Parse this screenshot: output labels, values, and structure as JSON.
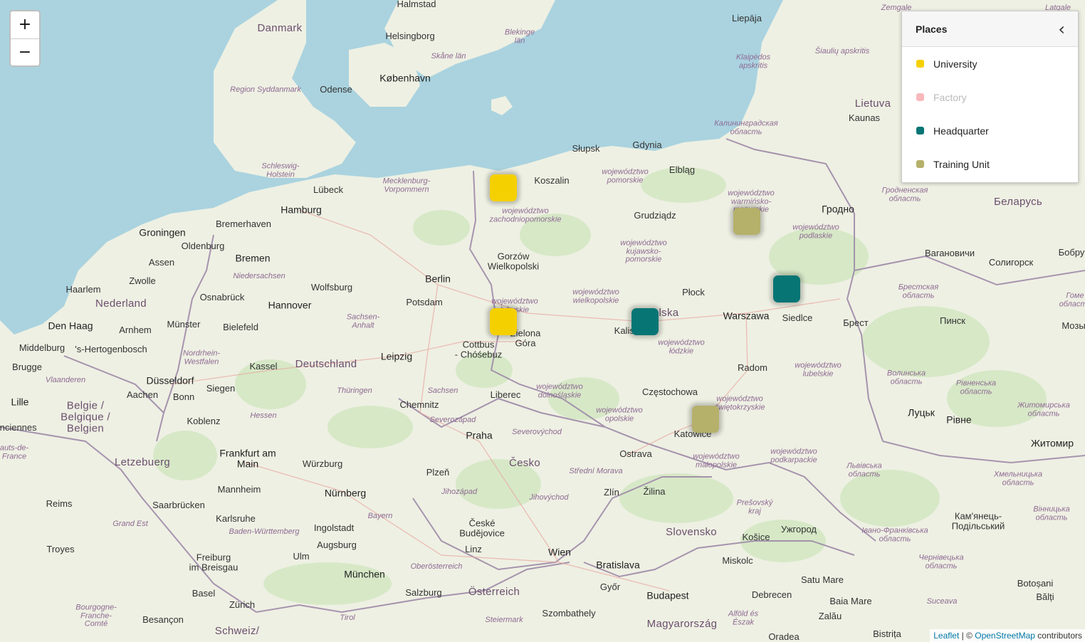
{
  "map": {
    "labels": [
      {
        "text": "Halmstad",
        "cls": ""
      },
      {
        "text": "Danmark",
        "cls": "country"
      },
      {
        "text": "Helsingborg",
        "cls": ""
      },
      {
        "text": "Blekinge\nlän",
        "cls": "region"
      },
      {
        "text": "Skåne län",
        "cls": "region"
      },
      {
        "text": "København",
        "cls": "city-major"
      },
      {
        "text": "Region Syddanmark",
        "cls": "region"
      },
      {
        "text": "Odense",
        "cls": ""
      },
      {
        "text": "Liepāja",
        "cls": ""
      },
      {
        "text": "Zemgale",
        "cls": "region"
      },
      {
        "text": "Latgale",
        "cls": "region"
      },
      {
        "text": "Klaipėdos\napskritis",
        "cls": "region"
      },
      {
        "text": "Šiaulių apskritis",
        "cls": "region"
      },
      {
        "text": "Lietuva",
        "cls": "country"
      },
      {
        "text": "Kaunas",
        "cls": ""
      },
      {
        "text": "Калининградская\nобласть",
        "cls": "region"
      },
      {
        "text": "Schleswig-\nHolstein",
        "cls": "region"
      },
      {
        "text": "Mecklenburg-\nVorpommern",
        "cls": "region"
      },
      {
        "text": "Lübeck",
        "cls": ""
      },
      {
        "text": "Koszalin",
        "cls": ""
      },
      {
        "text": "Słupsk",
        "cls": ""
      },
      {
        "text": "Gdynia",
        "cls": ""
      },
      {
        "text": "województwo\npomorskie",
        "cls": "region"
      },
      {
        "text": "Elbląg",
        "cls": ""
      },
      {
        "text": "województwo\nwarmińsko-\nmazurskie",
        "cls": "region"
      },
      {
        "text": "Гродненская\nобласть",
        "cls": "region"
      },
      {
        "text": "Беларусь",
        "cls": "country"
      },
      {
        "text": "Гродно",
        "cls": "city-major"
      },
      {
        "text": "Hamburg",
        "cls": "city-major"
      },
      {
        "text": "Groningen",
        "cls": "city-major"
      },
      {
        "text": "Bremerhaven",
        "cls": ""
      },
      {
        "text": "Oldenburg",
        "cls": ""
      },
      {
        "text": "Bremen",
        "cls": "city-major"
      },
      {
        "text": "województwo\nzachodniopomorskie",
        "cls": "region"
      },
      {
        "text": "Grudziądz",
        "cls": ""
      },
      {
        "text": "województwo\npodlaskie",
        "cls": "region"
      },
      {
        "text": "województwo\nkujawsko-\npomorskie",
        "cls": "region"
      },
      {
        "text": "Gorzów\nWielkopolski",
        "cls": ""
      },
      {
        "text": "Assen",
        "cls": ""
      },
      {
        "text": "Zwolle",
        "cls": ""
      },
      {
        "text": "Niedersachsen",
        "cls": "region"
      },
      {
        "text": "Barанoвичи",
        "cls": ""
      },
      {
        "text": "Солигорск",
        "cls": ""
      },
      {
        "text": "Бобру",
        "cls": ""
      },
      {
        "text": "Berlin",
        "cls": "city-major"
      },
      {
        "text": "Haarlem",
        "cls": ""
      },
      {
        "text": "Osnabrück",
        "cls": ""
      },
      {
        "text": "Wolfsburg",
        "cls": ""
      },
      {
        "text": "Potsdam",
        "cls": ""
      },
      {
        "text": "Płock",
        "cls": ""
      },
      {
        "text": "Siedlce",
        "cls": ""
      },
      {
        "text": "Брестская\nобласть",
        "cls": "region"
      },
      {
        "text": "Гоме\nобласть",
        "cls": "region"
      },
      {
        "text": "Nederland",
        "cls": "country"
      },
      {
        "text": "Hannover",
        "cls": "city-major"
      },
      {
        "text": "województwo\nlubuskie",
        "cls": "region"
      },
      {
        "text": "województwo\nwielkopolskie",
        "cls": "region"
      },
      {
        "text": "Polska",
        "cls": "country"
      },
      {
        "text": "Warszawa",
        "cls": "city-major"
      },
      {
        "text": "Брест",
        "cls": ""
      },
      {
        "text": "Пинск",
        "cls": ""
      },
      {
        "text": "Мозы",
        "cls": ""
      },
      {
        "text": "Den Haag",
        "cls": "city-major"
      },
      {
        "text": "Arnhem",
        "cls": ""
      },
      {
        "text": "Münster",
        "cls": ""
      },
      {
        "text": "Bielefeld",
        "cls": ""
      },
      {
        "text": "Sachsen-\nAnhalt",
        "cls": "region"
      },
      {
        "text": "Zielona\nGóra",
        "cls": ""
      },
      {
        "text": "Kalisz",
        "cls": ""
      },
      {
        "text": "województwo\nłódzkie",
        "cls": "region"
      },
      {
        "text": "Middelburg",
        "cls": ""
      },
      {
        "text": "'s-Hertogenbosch",
        "cls": ""
      },
      {
        "text": "Nordrhein-\nWestfalen",
        "cls": "region"
      },
      {
        "text": "Cottbus\n- Chóśebuz",
        "cls": ""
      },
      {
        "text": "Leipzig",
        "cls": "city-major"
      },
      {
        "text": "Radom",
        "cls": ""
      },
      {
        "text": "województwo\nlubelskie",
        "cls": "region"
      },
      {
        "text": "Волинська\nобласть",
        "cls": "region"
      },
      {
        "text": "Рівненська\nобласть",
        "cls": "region"
      },
      {
        "text": "Житомирська\nобласть",
        "cls": "region"
      },
      {
        "text": "Brugge",
        "cls": ""
      },
      {
        "text": "Düsseldorf",
        "cls": "city-major"
      },
      {
        "text": "Kassel",
        "cls": ""
      },
      {
        "text": "Deutschland",
        "cls": "country"
      },
      {
        "text": "Vlaanderen",
        "cls": "region"
      },
      {
        "text": "Aachen",
        "cls": ""
      },
      {
        "text": "Siegen",
        "cls": ""
      },
      {
        "text": "Thüringen",
        "cls": "region"
      },
      {
        "text": "Sachsen",
        "cls": "region"
      },
      {
        "text": "Liberec",
        "cls": ""
      },
      {
        "text": "województwo\ndolnośląskie",
        "cls": "region"
      },
      {
        "text": "Częstochowa",
        "cls": ""
      },
      {
        "text": "województwo\nświętokrzyskie",
        "cls": "region"
      },
      {
        "text": "Lille",
        "cls": "city-major"
      },
      {
        "text": "Bonn",
        "cls": ""
      },
      {
        "text": "Belgie /\nBelgique /\nBelgien",
        "cls": "country"
      },
      {
        "text": "Chemnitz",
        "cls": ""
      },
      {
        "text": "Луцьк",
        "cls": "city-major"
      },
      {
        "text": "Рівне",
        "cls": "city-major"
      },
      {
        "text": "Hessen",
        "cls": "region"
      },
      {
        "text": "Koblenz",
        "cls": ""
      },
      {
        "text": "Severozápad",
        "cls": "region"
      },
      {
        "text": "województwo\nopolskie",
        "cls": "region"
      },
      {
        "text": "Katowice",
        "cls": ""
      },
      {
        "text": "Житомир",
        "cls": "city-major"
      },
      {
        "text": "Praha",
        "cls": "city-major"
      },
      {
        "text": "Severovýchod",
        "cls": "region"
      },
      {
        "text": "Ostrava",
        "cls": ""
      },
      {
        "text": "Frankfurt am\nMain",
        "cls": "city-major"
      },
      {
        "text": "Würzburg",
        "cls": ""
      },
      {
        "text": "Letzebuerg",
        "cls": "country"
      },
      {
        "text": "Plzeň",
        "cls": ""
      },
      {
        "text": "Česko",
        "cls": "country"
      },
      {
        "text": "województwo\nmałopolskie",
        "cls": "region"
      },
      {
        "text": "województwo\npodkarpackie",
        "cls": "region"
      },
      {
        "text": "Львівська\nобласть",
        "cls": "region"
      },
      {
        "text": "Хмельницька\nобласть",
        "cls": "region"
      },
      {
        "text": "Mannheim",
        "cls": ""
      },
      {
        "text": "Nürnberg",
        "cls": "city-major"
      },
      {
        "text": "Střední Morava",
        "cls": "region"
      },
      {
        "text": "Jihozápad",
        "cls": "region"
      },
      {
        "text": "Zlín",
        "cls": ""
      },
      {
        "text": "Žilina",
        "cls": ""
      },
      {
        "text": "Reims",
        "cls": ""
      },
      {
        "text": "Saarbrücken",
        "cls": ""
      },
      {
        "text": "Jihovýchod",
        "cls": "region"
      },
      {
        "text": "Prešovský\nkraj",
        "cls": "region"
      },
      {
        "text": "Кам'янець-\nПодільський",
        "cls": ""
      },
      {
        "text": "Вінницька\nобласть",
        "cls": "region"
      },
      {
        "text": "Karlsruhe",
        "cls": ""
      },
      {
        "text": "Bayern",
        "cls": "region"
      },
      {
        "text": "České\nBudějovice",
        "cls": ""
      },
      {
        "text": "Grand Est",
        "cls": "region"
      },
      {
        "text": "Baden-Württemberg",
        "cls": "region"
      },
      {
        "text": "Ingolstadt",
        "cls": ""
      },
      {
        "text": "Slovensko",
        "cls": "country"
      },
      {
        "text": "Košice",
        "cls": ""
      },
      {
        "text": "Ужгород",
        "cls": ""
      },
      {
        "text": "Івано-Франківська\nобласть",
        "cls": "region"
      },
      {
        "text": "Augsburg",
        "cls": ""
      },
      {
        "text": "Linz",
        "cls": ""
      },
      {
        "text": "Troyes",
        "cls": ""
      },
      {
        "text": "Wien",
        "cls": "city-major"
      },
      {
        "text": "Ulm",
        "cls": ""
      },
      {
        "text": "Freiburg\nim Breisgau",
        "cls": ""
      },
      {
        "text": "Bratislava",
        "cls": "city-major"
      },
      {
        "text": "Miskolc",
        "cls": ""
      },
      {
        "text": "Чернівецька\nобласть",
        "cls": "region"
      },
      {
        "text": "Oberösterreich",
        "cls": "region"
      },
      {
        "text": "München",
        "cls": "city-major"
      },
      {
        "text": "Satu Mare",
        "cls": ""
      },
      {
        "text": "Botoșani",
        "cls": ""
      },
      {
        "text": "Győr",
        "cls": ""
      },
      {
        "text": "Basel",
        "cls": ""
      },
      {
        "text": "Salzburg",
        "cls": ""
      },
      {
        "text": "Österreich",
        "cls": "country"
      },
      {
        "text": "Budapest",
        "cls": "city-major"
      },
      {
        "text": "Debrecen",
        "cls": ""
      },
      {
        "text": "Baia Mare",
        "cls": ""
      },
      {
        "text": "Bălți",
        "cls": ""
      },
      {
        "text": "Zürich",
        "cls": ""
      },
      {
        "text": "Suceava",
        "cls": "region"
      },
      {
        "text": "Bourgogne-\nFranche-\nComté",
        "cls": "region"
      },
      {
        "text": "Szombathely",
        "cls": ""
      },
      {
        "text": "Alföld és\nÉszak",
        "cls": "region"
      },
      {
        "text": "Zalău",
        "cls": ""
      },
      {
        "text": "Besançon",
        "cls": ""
      },
      {
        "text": "Tirol",
        "cls": "region"
      },
      {
        "text": "Steiermark",
        "cls": "region"
      },
      {
        "text": "Magyarország",
        "cls": "country"
      },
      {
        "text": "Schweiz/",
        "cls": "country"
      },
      {
        "text": "Oradea",
        "cls": ""
      },
      {
        "text": "Bistrița",
        "cls": ""
      },
      {
        "text": "enciennes",
        "cls": ""
      },
      {
        "text": "auts-de-\nFrance",
        "cls": "region"
      }
    ],
    "markers": [
      {
        "name": "university-marker",
        "category": "University",
        "color": "#f5d000"
      },
      {
        "name": "university-marker",
        "category": "University",
        "color": "#f5d000"
      },
      {
        "name": "training-unit-marker",
        "category": "Training Unit",
        "color": "#b5b06a"
      },
      {
        "name": "training-unit-marker",
        "category": "Training Unit",
        "color": "#b5b06a"
      },
      {
        "name": "headquarter-marker",
        "category": "Headquarter",
        "color": "#087575"
      },
      {
        "name": "headquarter-marker",
        "category": "Headquarter",
        "color": "#087575"
      }
    ]
  },
  "zoom": {
    "in_label": "+",
    "out_label": "−"
  },
  "legend": {
    "title": "Places",
    "collapse_icon": "‹",
    "items": [
      {
        "label": "University",
        "color": "#f5d000",
        "enabled": true
      },
      {
        "label": "Factory",
        "color": "#f8b9bd",
        "enabled": false
      },
      {
        "label": "Headquarter",
        "color": "#087575",
        "enabled": true
      },
      {
        "label": "Training Unit",
        "color": "#b5b06a",
        "enabled": true
      }
    ]
  },
  "attribution": {
    "leaflet": "Leaflet",
    "separator": " | © ",
    "osm": "OpenStreetMap",
    "suffix": " contributors"
  }
}
